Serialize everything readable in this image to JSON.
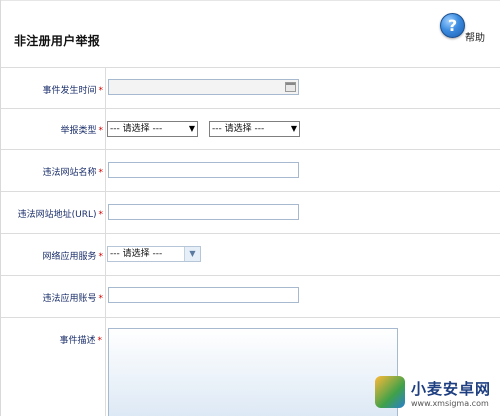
{
  "header": {
    "title": "非注册用户举报",
    "help_label": "帮助",
    "help_icon_glyph": "?"
  },
  "required_mark": "*",
  "form": {
    "event_time": {
      "label": "事件发生时间",
      "value": ""
    },
    "report_type": {
      "label": "举报类型",
      "select1": "--- 请选择 ---",
      "select2": "--- 请选择 ---"
    },
    "site_name": {
      "label": "违法网站名称",
      "value": ""
    },
    "site_url": {
      "label": "违法网站地址(URL)",
      "value": ""
    },
    "app_service": {
      "label": "网络应用服务",
      "select": "--- 请选择 ---"
    },
    "app_account": {
      "label": "违法应用账号",
      "value": ""
    },
    "description": {
      "label": "事件描述",
      "value": ""
    }
  },
  "watermark": {
    "title": "小麦安卓网",
    "url": "www.xmsigma.com"
  },
  "colors": {
    "label_text": "#1b2f6b",
    "required": "#d40000",
    "border": "#dcdcdc",
    "input_border": "#a7b9cf"
  }
}
